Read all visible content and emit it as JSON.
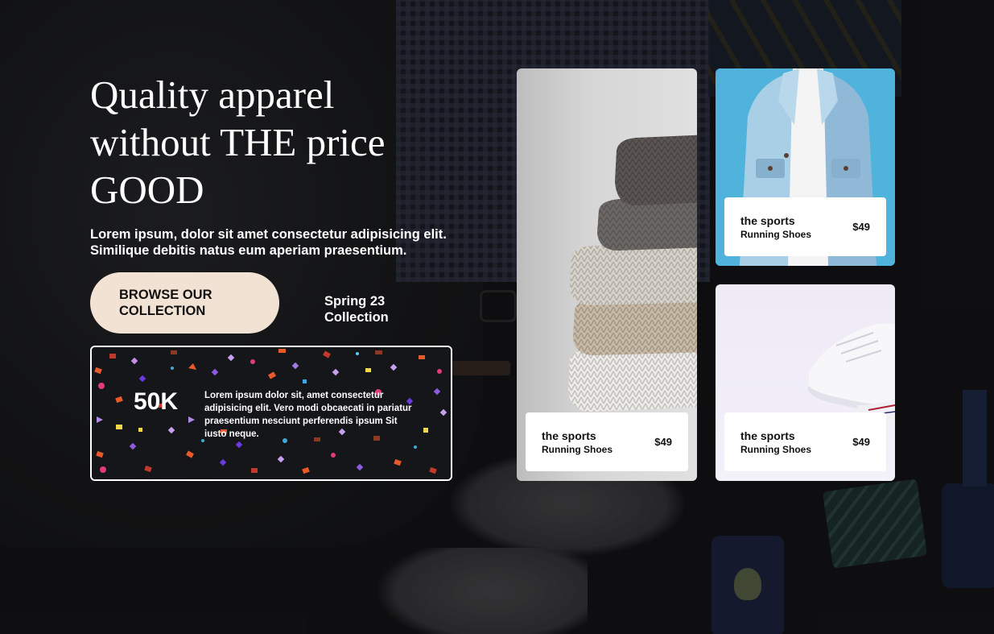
{
  "hero": {
    "title": "Quality apparel without THE price GOOD",
    "subtitle": "Lorem ipsum, dolor sit amet consectetur adipisicing elit. Similique debitis natus eum aperiam praesentium.",
    "cta_label": "BROWSE OUR COLLECTION",
    "collection_label": "Spring 23 Collection"
  },
  "stats": {
    "number": "50K",
    "text": "Lorem ipsum dolor sit, amet consectetur adipisicing elit. Vero modi obcaecati in pariatur praesentium nesciunt perferendis ipsum Sit iusto neque."
  },
  "products": [
    {
      "title": "the sports",
      "subtitle": "Running Shoes",
      "price": "$49",
      "image": "folded-sweaters"
    },
    {
      "title": "the sports",
      "subtitle": "Running Shoes",
      "price": "$49",
      "image": "denim-jacket"
    },
    {
      "title": "the sports",
      "subtitle": "Running Shoes",
      "price": "$49",
      "image": "white-sneakers"
    }
  ],
  "colors": {
    "cta_background": "#f2e2d4",
    "page_background": "#141416",
    "card_text": "#111111",
    "jacket_card_background": "#4fb3dc"
  }
}
